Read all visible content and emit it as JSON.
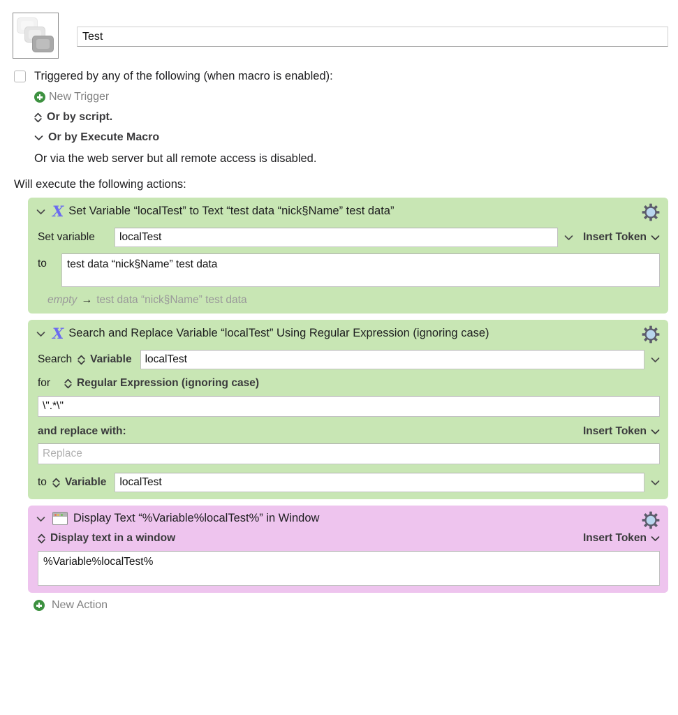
{
  "macro": {
    "icon_name": "macro-group-icon",
    "name_value": "Test"
  },
  "trigger": {
    "checkbox_label": "Triggered by any of the following (when macro is enabled):",
    "new_trigger_label": "New Trigger",
    "or_by_script": "Or by script.",
    "or_by_execute_macro": "Or by Execute Macro",
    "web_server_note": "Or via the web server but all remote access is disabled.",
    "will_execute": "Will execute the following actions:"
  },
  "actions": [
    {
      "color": "green",
      "accent_hex": "#c8e6b4",
      "icon_name": "variable-x-icon",
      "title": "Set Variable “localTest” to Text “test data “nick§Name” test data”",
      "set_variable_label": "Set variable",
      "variable_value": "localTest",
      "insert_token_label": "Insert Token",
      "to_label": "to",
      "text_value": "test data “nick§Name” test data",
      "result_from": "empty",
      "result_arrow": "→",
      "result_to": "test data “nick§Name” test data"
    },
    {
      "color": "green",
      "accent_hex": "#c8e6b4",
      "icon_name": "variable-x-icon",
      "title": "Search and Replace Variable “localTest” Using Regular Expression (ignoring case)",
      "search_label": "Search",
      "search_source": "Variable",
      "search_variable_value": "localTest",
      "for_label": "for",
      "match_mode": "Regular Expression (ignoring case)",
      "pattern_value": "\\\".*\\\"",
      "replace_with_label": "and replace with:",
      "insert_token_label": "Insert Token",
      "replace_placeholder": "Replace",
      "replace_value": "",
      "to_label": "to",
      "destination_kind": "Variable",
      "destination_value": "localTest"
    },
    {
      "color": "purple",
      "accent_hex": "#eec4ee",
      "icon_name": "window-icon",
      "title": "Display Text “%Variable%localTest%” in Window",
      "display_mode": "Display text in a window",
      "insert_token_label": "Insert Token",
      "text_value": "%Variable%localTest%"
    }
  ],
  "footer": {
    "new_action_label": "New Action"
  }
}
